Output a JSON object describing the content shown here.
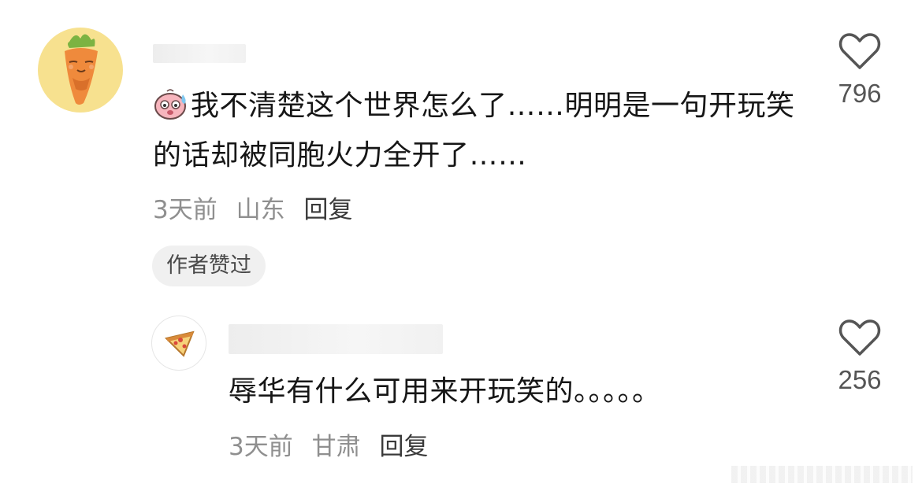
{
  "comment": {
    "avatar_icon": "carrot-avatar-icon",
    "emoji_icon": "pink-blob-sweat-emoji-icon",
    "text": "我不清楚这个世界怎么了……明明是一句开玩笑的话却被同胞火力全开了……",
    "time": "3天前",
    "location": "山东",
    "reply_label": "回复",
    "badge": "作者赞过",
    "likes": "796"
  },
  "reply": {
    "avatar_icon": "pizza-avatar-icon",
    "text": "辱华有什么可用来开玩笑的。。。。。",
    "time": "3天前",
    "location": "甘肃",
    "reply_label": "回复",
    "likes": "256"
  },
  "colors": {
    "avatar_bg": "#f7e18f",
    "meta_gray": "#8f8f8f",
    "badge_bg": "#f0f0f0"
  }
}
